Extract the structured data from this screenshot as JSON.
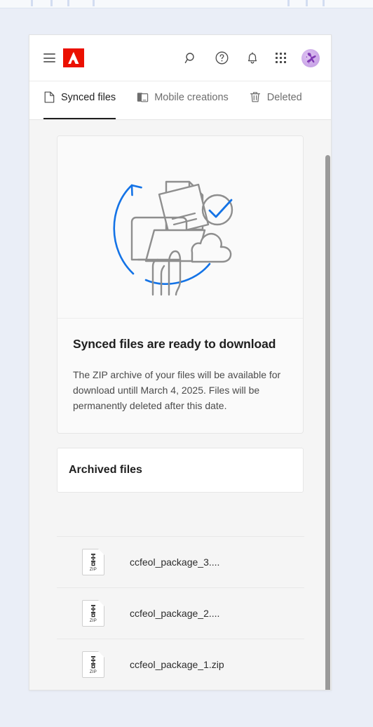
{
  "browser_chrome": {
    "tick_positions": [
      44,
      72,
      96,
      132,
      410,
      436,
      460
    ]
  },
  "header": {
    "menu_icon": "hamburger-menu-icon",
    "logo": "adobe-logo",
    "logo_color": "#EB1000",
    "icons": [
      {
        "name": "search-icon",
        "label": "Search"
      },
      {
        "name": "help-icon",
        "label": "Help"
      },
      {
        "name": "notifications-bell-icon",
        "label": "Notifications"
      },
      {
        "name": "app-switcher-grid-icon",
        "label": "Apps"
      }
    ],
    "avatar": {
      "name": "user-avatar",
      "color": "#C39BE4"
    }
  },
  "tabs": [
    {
      "id": "synced-files",
      "label": "Synced files",
      "icon": "document-icon",
      "active": true
    },
    {
      "id": "mobile-creations",
      "label": "Mobile creations",
      "icon": "mobile-device-icon",
      "active": false
    },
    {
      "id": "deleted",
      "label": "Deleted",
      "icon": "trash-icon",
      "active": false
    }
  ],
  "hero": {
    "illustration_name": "synced-files-download-illustration",
    "accent_color": "#1473E6",
    "line_color": "#8E8E8E",
    "title": "Synced files are ready to download",
    "body": "The ZIP archive of your files will be available for download untill March 4, 2025. Files will be permanently deleted after this date."
  },
  "archived": {
    "title": "Archived files"
  },
  "file_list": [
    {
      "icon": "zip-file-icon",
      "icon_label": "ZIP",
      "name": "ccfeol_package_3...."
    },
    {
      "icon": "zip-file-icon",
      "icon_label": "ZIP",
      "name": "ccfeol_package_2...."
    },
    {
      "icon": "zip-file-icon",
      "icon_label": "ZIP",
      "name": "ccfeol_package_1.zip"
    }
  ],
  "scrollbar": {
    "name": "vertical-scrollbar"
  }
}
